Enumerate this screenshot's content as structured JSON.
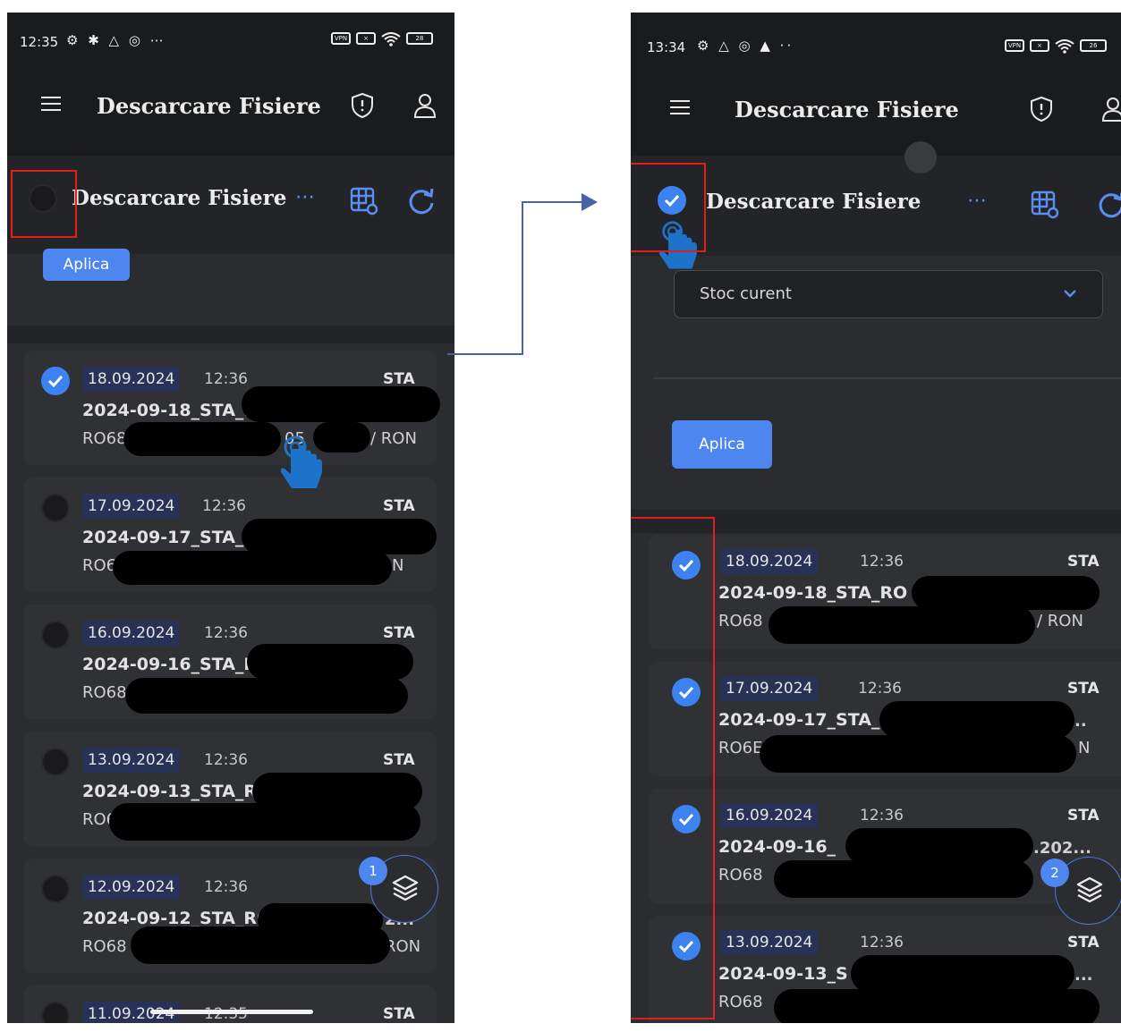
{
  "left": {
    "status": {
      "time": "12:35",
      "icons": "⚙ ✱ △ ◎ ⋯"
    },
    "appbar": {
      "title": "Descarcare Fisiere"
    },
    "section": {
      "title": "Descarcare Fisiere",
      "more": "⋯",
      "apply": "Aplica"
    },
    "files": [
      {
        "date": "18.09.2024",
        "time": "12:36",
        "tag": "STA",
        "name": "2024-09-18_STA_RC",
        "acct": "RO68",
        "tail": "05",
        "tail2": "/ RON",
        "checked": true
      },
      {
        "date": "17.09.2024",
        "time": "12:36",
        "tag": "STA",
        "name": "2024-09-17_STA_RC",
        "acct": "RO6",
        "tail": "",
        "tail2": "N",
        "checked": false
      },
      {
        "date": "16.09.2024",
        "time": "12:36",
        "tag": "STA",
        "name": "2024-09-16_STA_RC",
        "acct": "RO68",
        "tail": "",
        "tail2": "",
        "checked": false
      },
      {
        "date": "13.09.2024",
        "time": "12:36",
        "tag": "STA",
        "name": "2024-09-13_STA_RO6",
        "acct": "RO6",
        "tail": "",
        "tail2": "",
        "checked": false
      },
      {
        "date": "12.09.2024",
        "time": "12:36",
        "tag": "STA",
        "name": "2024-09-12_STA_RO6",
        "acct": "RO68 L",
        "tail": "2...",
        "tail2": "RON",
        "checked": false
      },
      {
        "date": "11.09.2024",
        "time": "12:35",
        "tag": "STA",
        "name": "",
        "acct": "",
        "tail": "",
        "tail2": "",
        "checked": false
      }
    ],
    "fab_badge": "1"
  },
  "right": {
    "status": {
      "time": "13:34",
      "icons": "⚙ △ ◎ ▲ ··"
    },
    "appbar": {
      "title": "Descarcare Fisiere"
    },
    "section": {
      "title": "Descarcare Fisiere",
      "more": "⋯",
      "select_value": "Stoc curent",
      "apply": "Aplica"
    },
    "files": [
      {
        "date": "18.09.2024",
        "time": "12:36",
        "tag": "STA",
        "name": "2024-09-18_STA_RO",
        "acct": "RO68",
        "tail": "",
        "tail2": "/ RON",
        "checked": true
      },
      {
        "date": "17.09.2024",
        "time": "12:36",
        "tag": "STA",
        "name": "2024-09-17_STA_",
        "acct": "RO6E",
        "tail": "..",
        "tail2": "N",
        "checked": true
      },
      {
        "date": "16.09.2024",
        "time": "12:36",
        "tag": "STA",
        "name": "2024-09-16_",
        "acct": "RO68",
        "tail": ".202...",
        "tail2": "",
        "checked": true
      },
      {
        "date": "13.09.2024",
        "time": "12:36",
        "tag": "STA",
        "name": "2024-09-13_S",
        "acct": "RO68",
        "tail": "...",
        "tail2": "",
        "checked": true
      }
    ],
    "fab_badge": "2"
  },
  "colors": {
    "accent": "#4d86ee",
    "background": "#252629",
    "annotation": "#e11d1d"
  }
}
